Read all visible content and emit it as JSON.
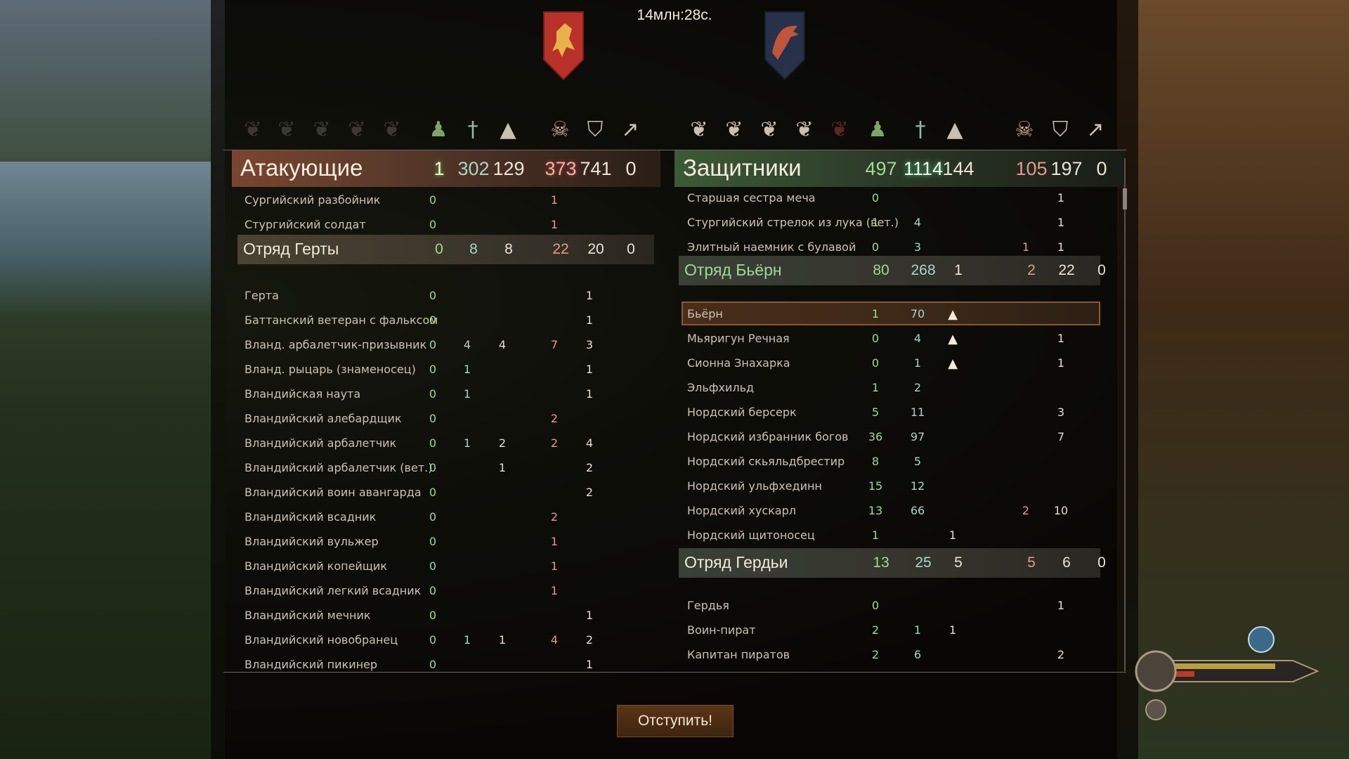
{
  "timer": "14млн:28с.",
  "colors": {
    "attacker_accent": "#7a4530",
    "defender_accent": "#3d5a36",
    "retreat_button": "#4a2c13"
  },
  "header_icons": [
    "banner-icon",
    "banner-icon",
    "banner-icon",
    "banner-icon",
    "banner-icon",
    "remaining-troops-icon",
    "wounded-sword-icon",
    "rankup-arrow-icon",
    "skull-icon",
    "shield-lightning-icon",
    "routed-icon"
  ],
  "attackers": {
    "title": "Атакующие",
    "stats": [
      "1",
      "302",
      "129",
      "373",
      "741",
      "0"
    ],
    "units_top": [
      {
        "name": "Сургийский разбойник",
        "v": [
          "0",
          "",
          "",
          "1",
          "",
          ""
        ]
      },
      {
        "name": "Стургийский солдат",
        "v": [
          "0",
          "",
          "",
          "1",
          "",
          ""
        ]
      }
    ],
    "party": {
      "name": "Отряд Герты",
      "stats": [
        "0",
        "8",
        "8",
        "22",
        "20",
        "0"
      ]
    },
    "units": [
      {
        "name": "Герта",
        "v": [
          "0",
          "",
          "",
          "",
          "1",
          ""
        ]
      },
      {
        "name": "Баттанский ветеран с фальксом",
        "v": [
          "0",
          "",
          "",
          "",
          "1",
          ""
        ]
      },
      {
        "name": "Вланд. арбалетчик-призывник",
        "v": [
          "0",
          "4",
          "4",
          "7",
          "3",
          ""
        ]
      },
      {
        "name": "Вланд. рыцарь (знаменосец)",
        "v": [
          "0",
          "1",
          "",
          "",
          "1",
          ""
        ]
      },
      {
        "name": "Вландийская наута",
        "v": [
          "0",
          "1",
          "",
          "",
          "1",
          ""
        ]
      },
      {
        "name": "Вландийский алебардщик",
        "v": [
          "0",
          "",
          "",
          "2",
          "",
          ""
        ]
      },
      {
        "name": "Вландийский арбалетчик",
        "v": [
          "0",
          "1",
          "2",
          "2",
          "4",
          ""
        ]
      },
      {
        "name": "Вландийский арбалетчик (вет.)",
        "v": [
          "0",
          "",
          "1",
          "",
          "2",
          ""
        ]
      },
      {
        "name": "Вландийский воин авангарда",
        "v": [
          "0",
          "",
          "",
          "",
          "2",
          ""
        ]
      },
      {
        "name": "Вландийский всадник",
        "v": [
          "0",
          "",
          "",
          "2",
          "",
          ""
        ]
      },
      {
        "name": "Вландийский вульжер",
        "v": [
          "0",
          "",
          "",
          "1",
          "",
          ""
        ]
      },
      {
        "name": "Вландийский копейщик",
        "v": [
          "0",
          "",
          "",
          "1",
          "",
          ""
        ]
      },
      {
        "name": "Вландийский легкий всадник",
        "v": [
          "0",
          "",
          "",
          "1",
          "",
          ""
        ]
      },
      {
        "name": "Вландийский мечник",
        "v": [
          "0",
          "",
          "",
          "",
          "1",
          ""
        ]
      },
      {
        "name": "Вландийский новобранец",
        "v": [
          "0",
          "1",
          "1",
          "4",
          "2",
          ""
        ]
      },
      {
        "name": "Вландийский пикинер",
        "v": [
          "0",
          "",
          "",
          "",
          "1",
          ""
        ]
      }
    ]
  },
  "defenders": {
    "title": "Защитники",
    "stats": [
      "497",
      "1114",
      "144",
      "105",
      "197",
      "0"
    ],
    "units_top": [
      {
        "name": "Старшая сестра меча",
        "v": [
          "0",
          "",
          "",
          "",
          "1",
          ""
        ]
      },
      {
        "name": "Стургийский стрелок из лука (вет.)",
        "v": [
          "1",
          "4",
          "",
          "",
          "1",
          ""
        ]
      },
      {
        "name": "Элитный наемник с булавой",
        "v": [
          "0",
          "3",
          "",
          "1",
          "1",
          ""
        ]
      }
    ],
    "party1": {
      "name": "Отряд Бьёрн",
      "stats": [
        "80",
        "268",
        "1",
        "2",
        "22",
        "0"
      ]
    },
    "units1": [
      {
        "name": "Бьёрн",
        "v": [
          "1",
          "70",
          "▲",
          "",
          "",
          ""
        ]
      },
      {
        "name": "Мьяригун Речная",
        "v": [
          "0",
          "4",
          "▲",
          "",
          "1",
          ""
        ]
      },
      {
        "name": "Сионна Знахарка",
        "v": [
          "0",
          "1",
          "▲",
          "",
          "1",
          ""
        ]
      },
      {
        "name": "Эльфхильд",
        "v": [
          "1",
          "2",
          "",
          "",
          "",
          ""
        ]
      },
      {
        "name": "Нордский берсерк",
        "v": [
          "5",
          "11",
          "",
          "",
          "3",
          ""
        ]
      },
      {
        "name": "Нордский избранник богов",
        "v": [
          "36",
          "97",
          "",
          "",
          "7",
          ""
        ]
      },
      {
        "name": "Нордский скьяльдбрестир",
        "v": [
          "8",
          "5",
          "",
          "",
          "",
          ""
        ]
      },
      {
        "name": "Нордский ульфхединн",
        "v": [
          "15",
          "12",
          "",
          "",
          "",
          ""
        ]
      },
      {
        "name": "Нордский хускарл",
        "v": [
          "13",
          "66",
          "",
          "2",
          "10",
          ""
        ]
      },
      {
        "name": "Нордский щитоносец",
        "v": [
          "1",
          "",
          "1",
          "",
          "",
          ""
        ]
      }
    ],
    "party2": {
      "name": "Отряд Гердьи",
      "stats": [
        "13",
        "25",
        "5",
        "5",
        "6",
        "0"
      ]
    },
    "units2": [
      {
        "name": "Гердья",
        "v": [
          "0",
          "",
          "",
          "",
          "1",
          ""
        ]
      },
      {
        "name": "Воин-пират",
        "v": [
          "2",
          "1",
          "1",
          "",
          "",
          ""
        ]
      },
      {
        "name": "Капитан пиратов",
        "v": [
          "2",
          "6",
          "",
          "",
          "2",
          ""
        ]
      }
    ]
  },
  "retreat_button": "Отступить!"
}
